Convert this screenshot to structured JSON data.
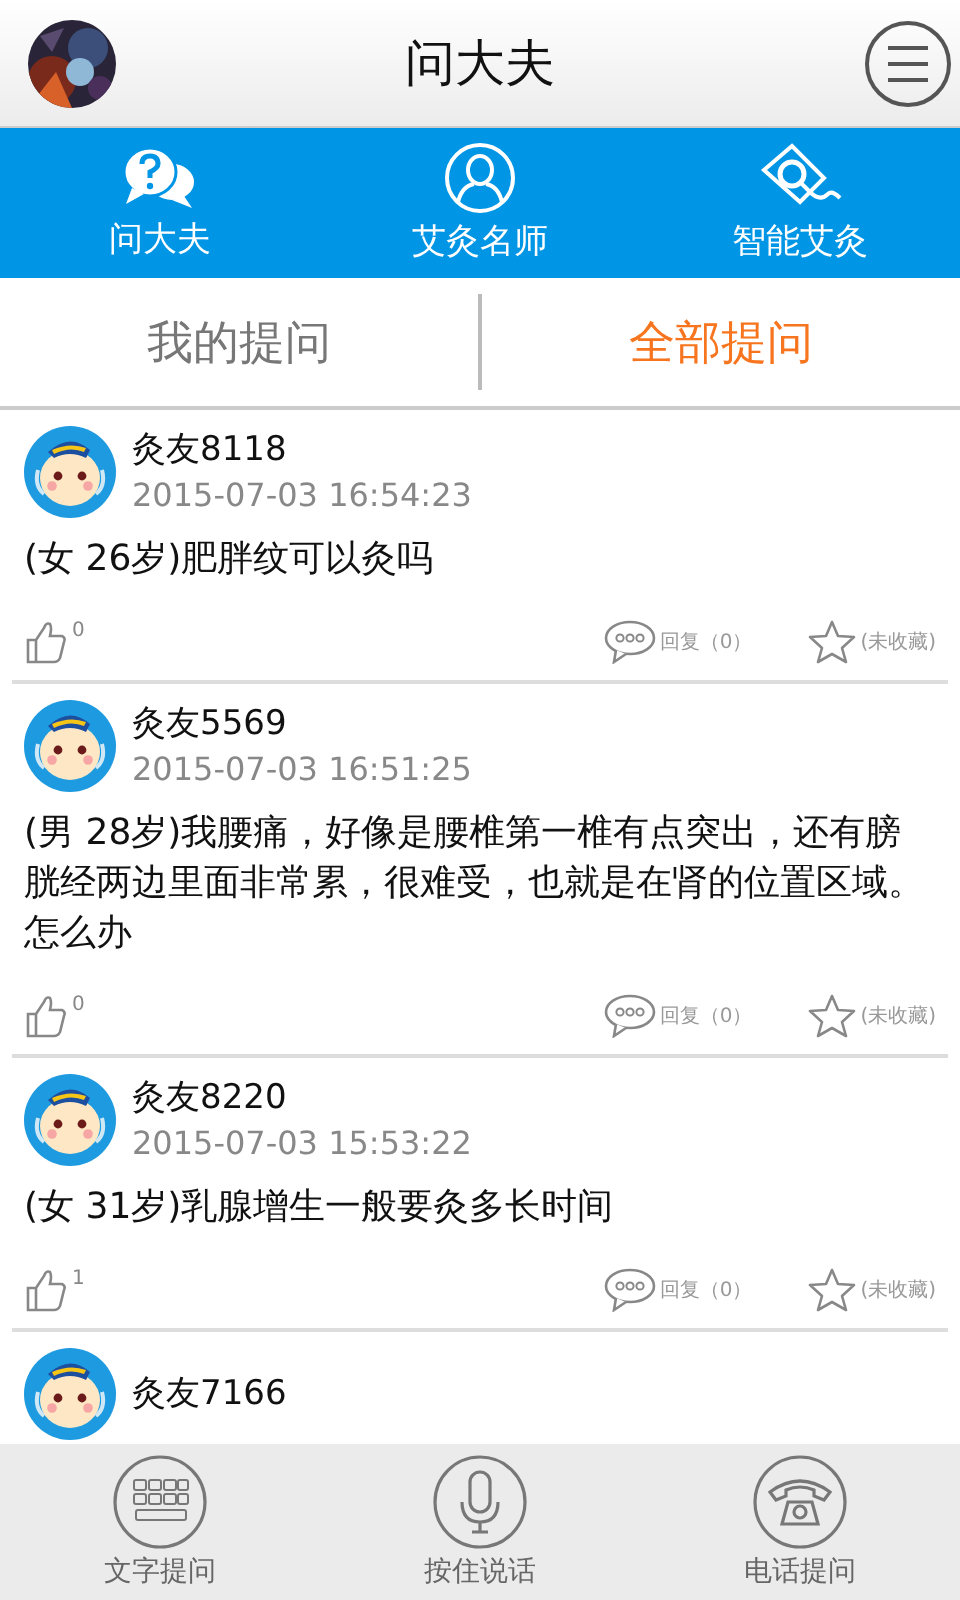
{
  "header": {
    "title": "问大夫"
  },
  "nav": [
    {
      "label": "问大夫",
      "kind": "ask"
    },
    {
      "label": "艾灸名师",
      "kind": "doctor"
    },
    {
      "label": "智能艾灸",
      "kind": "smart"
    }
  ],
  "tabs": [
    {
      "label": "我的提问",
      "selected": false
    },
    {
      "label": "全部提问",
      "selected": true
    }
  ],
  "posts": [
    {
      "user": "灸友8118",
      "time": "2015-07-03 16:54:23",
      "question": "(女 26岁)肥胖纹可以灸吗",
      "likes": "0",
      "replies": "回复（0）",
      "favorite": "(未收藏)"
    },
    {
      "user": "灸友5569",
      "time": "2015-07-03 16:51:25",
      "question": "(男 28岁)我腰痛，好像是腰椎第一椎有点突出，还有膀胱经两边里面非常累，很难受，也就是在肾的位置区域。怎么办",
      "likes": "0",
      "replies": "回复（0）",
      "favorite": "(未收藏)"
    },
    {
      "user": "灸友8220",
      "time": "2015-07-03 15:53:22",
      "question": "(女 31岁)乳腺增生一般要灸多长时间",
      "likes": "1",
      "replies": "回复（0）",
      "favorite": "(未收藏)"
    },
    {
      "user": "灸友7166"
    }
  ],
  "bottom": [
    {
      "label": "文字提问",
      "kind": "keyboard"
    },
    {
      "label": "按住说话",
      "kind": "mic"
    },
    {
      "label": "电话提问",
      "kind": "phone"
    }
  ]
}
